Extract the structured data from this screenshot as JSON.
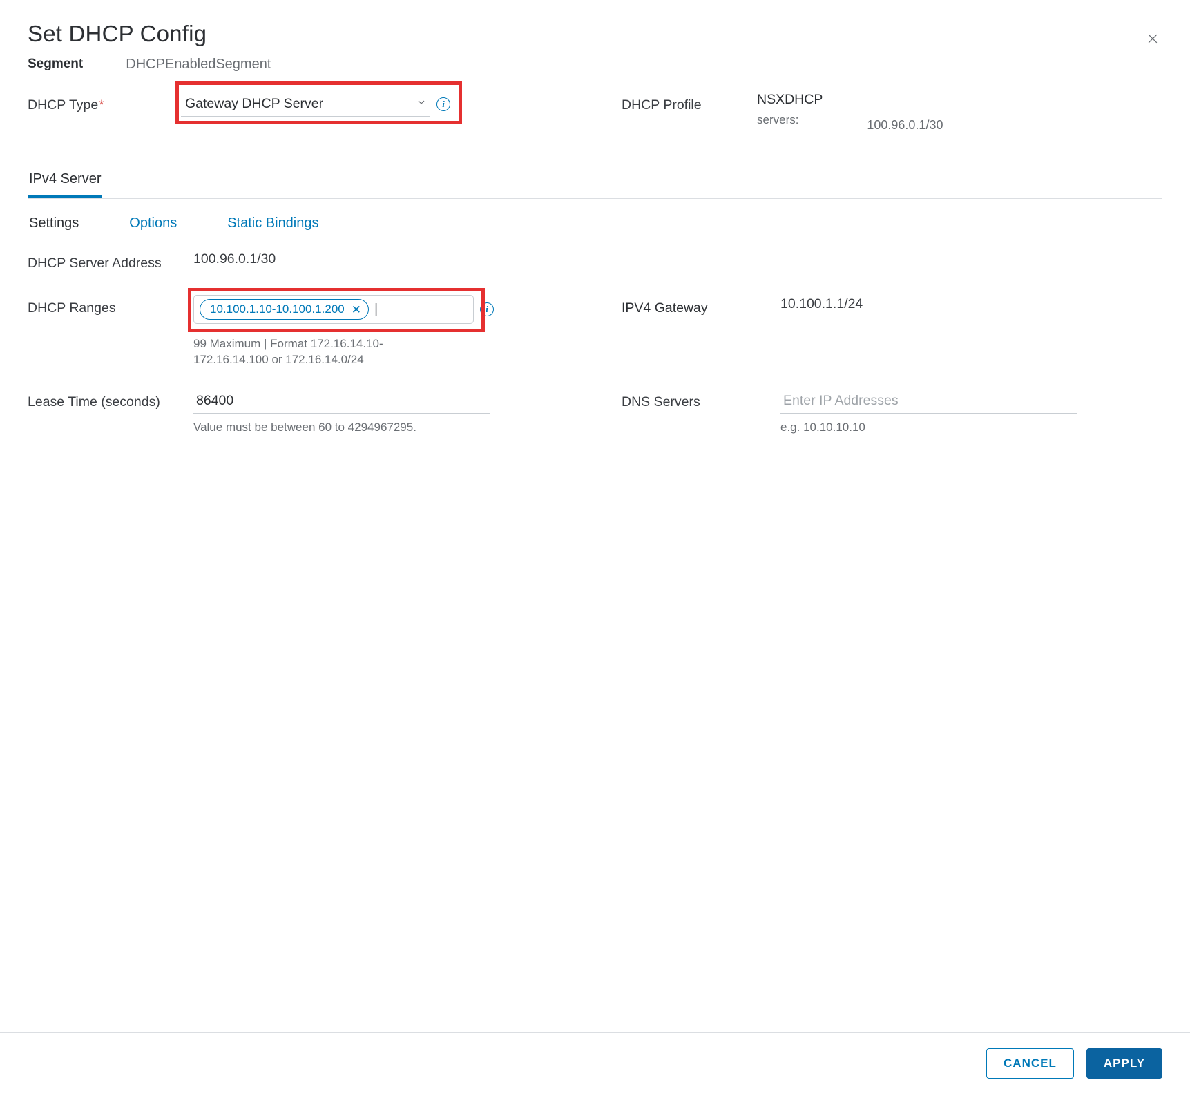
{
  "header": {
    "title": "Set DHCP Config",
    "segment_label": "Segment",
    "segment_value": "DHCPEnabledSegment"
  },
  "dhcp_type": {
    "label": "DHCP Type",
    "required_mark": "*",
    "selected": "Gateway DHCP Server"
  },
  "dhcp_profile": {
    "label": "DHCP Profile",
    "name": "NSXDHCP",
    "servers_label": "servers:",
    "servers_value": "100.96.0.1/30"
  },
  "tabs_main": {
    "ipv4_server": "IPv4 Server"
  },
  "subtabs": {
    "settings": "Settings",
    "options": "Options",
    "static_bindings": "Static Bindings"
  },
  "settings": {
    "server_address_label": "DHCP Server Address",
    "server_address_value": "100.96.0.1/30",
    "ranges_label": "DHCP Ranges",
    "ranges_chip": "10.100.1.10-10.100.1.200",
    "ranges_helper": "99 Maximum | Format 172.16.14.10-172.16.14.100 or 172.16.14.0/24",
    "ipv4_gateway_label": "IPV4 Gateway",
    "ipv4_gateway_value": "10.100.1.1/24",
    "lease_label": "Lease Time (seconds)",
    "lease_value": "86400",
    "lease_helper": "Value must be between 60 to 4294967295.",
    "dns_label": "DNS Servers",
    "dns_placeholder": "Enter IP Addresses",
    "dns_helper": "e.g. 10.10.10.10"
  },
  "footer": {
    "cancel": "CANCEL",
    "apply": "APPLY"
  },
  "icons": {
    "chip_remove": "✕",
    "text_cursor": "|",
    "info_glyph": "i"
  }
}
